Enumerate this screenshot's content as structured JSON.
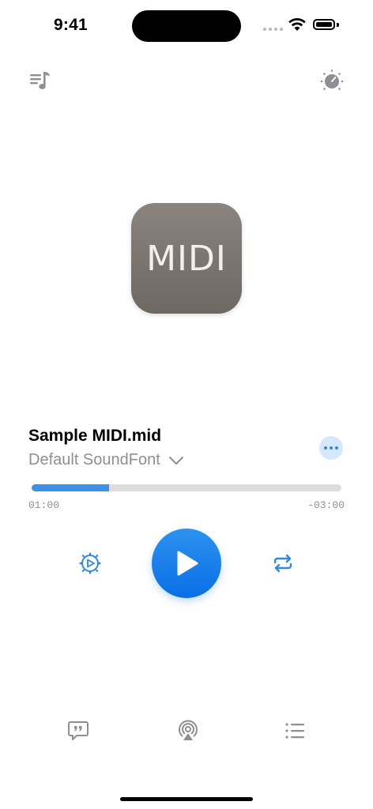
{
  "status_bar": {
    "time": "9:41",
    "battery_level": 1.0
  },
  "header": {
    "left_icon": "playlist-music-icon",
    "right_icon": "knob-icon"
  },
  "artwork": {
    "label": "MIDI",
    "color_top": "#8b847e",
    "color_bottom": "#6e6862"
  },
  "track": {
    "title": "Sample MIDI.mid",
    "soundfont": "Default SoundFont",
    "soundfont_icon": "chevron-down-icon",
    "more_icon": "ellipsis-icon"
  },
  "progress": {
    "elapsed": "01:00",
    "remaining": "-03:00",
    "fraction": 0.25
  },
  "controls": {
    "left_icon": "tempo-gear-icon",
    "center_icon": "play-icon",
    "right_icon": "repeat-icon"
  },
  "bottom_bar": {
    "items": [
      "lyrics-icon",
      "airplay-icon",
      "queue-list-icon"
    ]
  },
  "colors": {
    "accent": "#2f88e6",
    "play_button": "#1a80ec",
    "secondary_text": "#8e8e93",
    "track_bg": "#dddddd"
  }
}
